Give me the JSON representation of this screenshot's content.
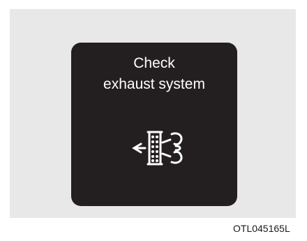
{
  "message": {
    "line1": "Check",
    "line2": "exhaust system"
  },
  "indicator": {
    "icon": "exhaust-system-warning-icon",
    "color": "#ffffff"
  },
  "display_color": "#231f20",
  "panel_color": "#e8e8e8",
  "figure_code": "OTL045165L"
}
